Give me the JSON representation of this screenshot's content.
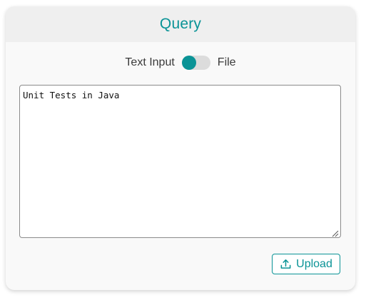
{
  "card": {
    "title": "Query"
  },
  "mode_toggle": {
    "left_label": "Text Input",
    "right_label": "File",
    "selected": "Text Input"
  },
  "query_input": {
    "value": "Unit Tests in Java"
  },
  "upload_button": {
    "label": "Upload",
    "icon": "upload-icon"
  },
  "colors": {
    "accent": "#0a9396",
    "header_bg": "#efefef",
    "card_bg": "#f9f9f9"
  }
}
